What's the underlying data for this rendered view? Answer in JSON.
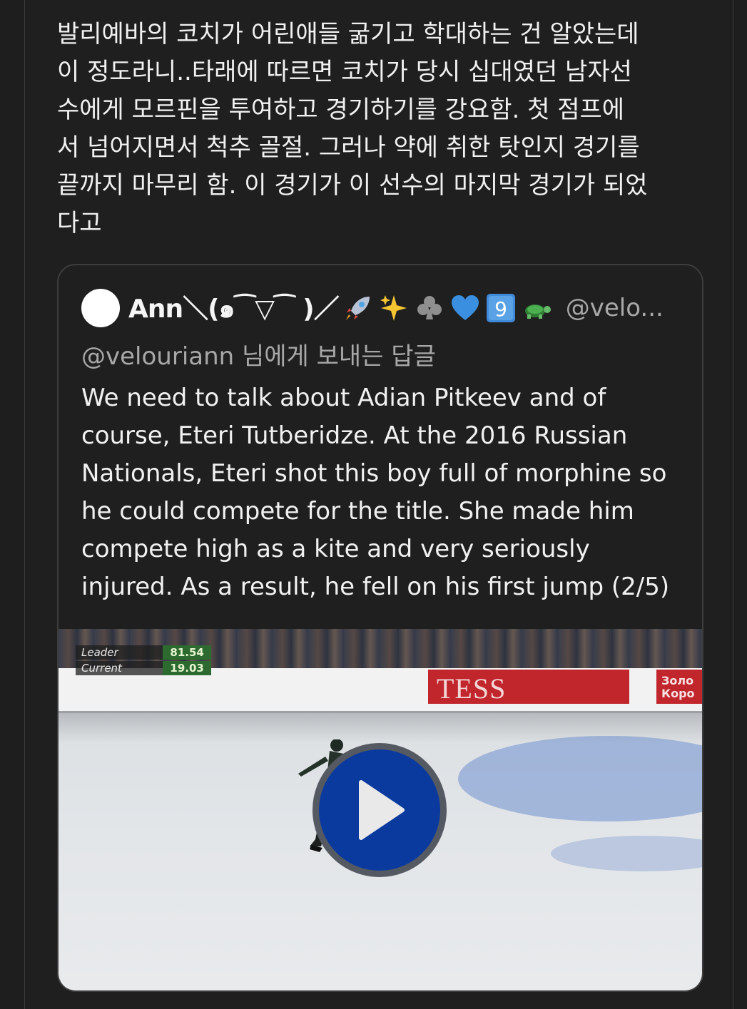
{
  "tweet": {
    "text": "발리예바의 코치가 어린애들 굶기고 학대하는 건 알았는데\n이 정도라니..타래에 따르면 코치가 당시 십대였던 남자선\n수에게 모르핀을 투여하고 경기하기를 강요함. 첫 점프에\n서 넘어지면서 척추 골절. 그러나 약에 취한 탓인지 경기를\n끝까지 마무리 함. 이 경기가 이 선수의 마지막 경기가 되었\n다고"
  },
  "quote": {
    "display_name": "Ann＼(๑⁀▽⁀ )／",
    "emojis": [
      "rocket-emoji",
      "sparkles-emoji",
      "club-suit-emoji",
      "blue-heart-emoji",
      "keycap-9-emoji",
      "turtle-emoji"
    ],
    "keycap_label": "9",
    "handle": "@velo...",
    "reply_to": "@velouriann 님에게 보내는 답글",
    "body": "We need to talk about Adian Pitkeev and of\ncourse, Eteri Tutberidze. At the 2016 Russian\nNationals, Eteri shot this boy full of morphine so\nhe could compete for the title. She made him\ncompete high as a kite and very seriously\ninjured. As a result, he fell on his first jump (2/5)"
  },
  "video": {
    "scoreboard": {
      "leader_label": "Leader",
      "leader_value": "81.54",
      "current_label": "Current",
      "current_value": "19.03"
    },
    "board_text": "TESS",
    "sponsor_text": "Золо\nКоро",
    "play_icon": "play-icon",
    "play_color": "#0b3a9e"
  }
}
